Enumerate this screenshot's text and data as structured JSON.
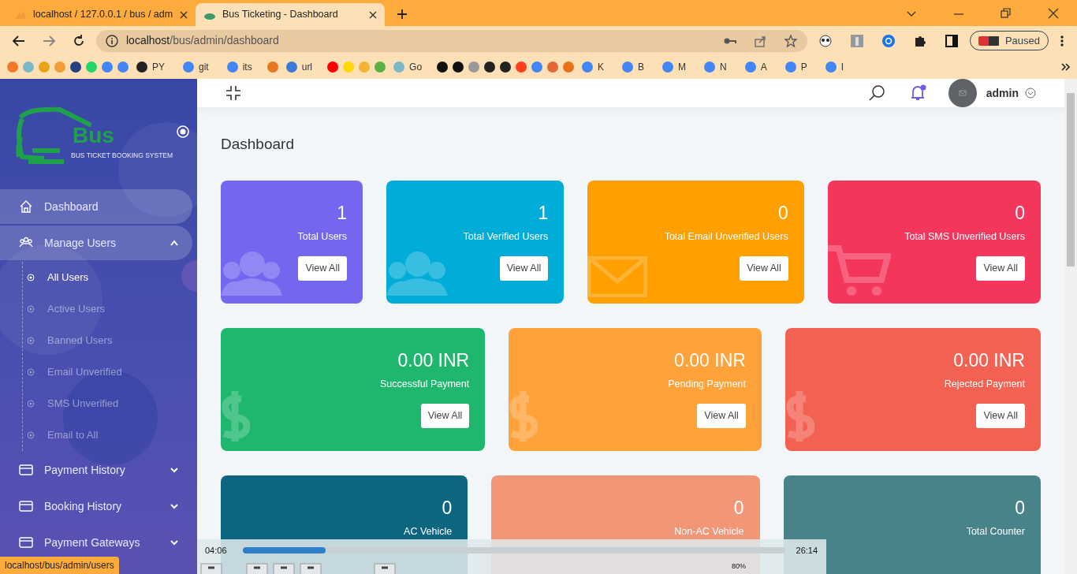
{
  "browser": {
    "tabs": [
      {
        "title": "localhost / 127.0.0.1 / bus / admi",
        "selected": false,
        "kind": "pma"
      },
      {
        "title": "Bus Ticketing - Dashboard",
        "selected": true,
        "kind": "bus"
      }
    ],
    "url_host": "localhost",
    "url_path": "/bus/admin/dashboard",
    "profile_status": "Paused",
    "bookmarks": [
      {
        "color": "#f07b2a"
      },
      {
        "color": "#7ab8c8"
      },
      {
        "color": "#e8a317"
      },
      {
        "color": "#f29d38"
      },
      {
        "color": "#23407f"
      },
      {
        "color": "#25d366"
      },
      {
        "color": "#4285f4"
      },
      {
        "color": "#4285f4"
      },
      {
        "color": "#222222",
        "label": "PY"
      },
      {
        "color": "#4285f4",
        "label": "git"
      },
      {
        "color": "#4285f4",
        "label": "its"
      },
      {
        "color": "#e87722"
      },
      {
        "color": "#3a7bd5",
        "label": "url"
      },
      {
        "color": "#ff0000"
      },
      {
        "color": "#ffd800"
      },
      {
        "color": "#f2b233"
      },
      {
        "color": "#5bb046"
      },
      {
        "color": "#7ab8c8",
        "label": "Go"
      },
      {
        "color": "#111111"
      },
      {
        "color": "#111111"
      },
      {
        "color": "#999999"
      },
      {
        "color": "#222222"
      },
      {
        "color": "#222222"
      },
      {
        "color": "#fc3f1d"
      },
      {
        "color": "#4285f4"
      },
      {
        "color": "#e16737"
      },
      {
        "color": "#e8711c"
      },
      {
        "color": "#4285f4",
        "label": "K"
      },
      {
        "color": "#4285f4",
        "label": "B"
      },
      {
        "color": "#4285f4",
        "label": "M"
      },
      {
        "color": "#4285f4",
        "label": "N"
      },
      {
        "color": "#4285f4",
        "label": "A"
      },
      {
        "color": "#4285f4",
        "label": "P"
      },
      {
        "color": "#4285f4",
        "label": "I"
      }
    ]
  },
  "sidebar": {
    "logo_word": "Bus",
    "logo_tagline": "BUS TICKET BOOKING SYSTEM",
    "items": [
      {
        "label": "Dashboard",
        "kind": "home",
        "selected": true
      },
      {
        "label": "Manage Users",
        "kind": "users",
        "selected": true,
        "expanded": true,
        "children": [
          {
            "label": "All Users",
            "selected": true
          },
          {
            "label": "Active Users",
            "selected": false
          },
          {
            "label": "Banned Users",
            "selected": false
          },
          {
            "label": "Email Unverified",
            "selected": false
          },
          {
            "label": "SMS Unverified",
            "selected": false
          },
          {
            "label": "Email to All",
            "selected": false
          }
        ]
      },
      {
        "label": "Payment History",
        "kind": "card",
        "selected": false,
        "expanded": false
      },
      {
        "label": "Booking History",
        "kind": "card",
        "selected": false,
        "expanded": false
      },
      {
        "label": "Payment Gateways",
        "kind": "card",
        "selected": false,
        "expanded": false
      }
    ]
  },
  "header": {
    "user": "admin"
  },
  "page_title": "Dashboard",
  "card_rows": [
    [
      {
        "value": "1",
        "label": "Total Users",
        "button": "View All",
        "color": "#7367f0",
        "kind": "users"
      },
      {
        "value": "1",
        "label": "Total Verified Users",
        "button": "View All",
        "color": "#00acd8",
        "kind": "users"
      },
      {
        "value": "0",
        "label": "Total Email Unverified Users",
        "button": "View All",
        "color": "#ff9f00",
        "kind": "mail"
      },
      {
        "value": "0",
        "label": "Total SMS Unverified Users",
        "button": "View All",
        "color": "#f5365c",
        "kind": "cart"
      }
    ],
    [
      {
        "value": "0.00 INR",
        "label": "Successful Payment",
        "button": "View All",
        "color": "#1fb66e",
        "kind": "dollar"
      },
      {
        "value": "0.00 INR",
        "label": "Pending Payment",
        "button": "View All",
        "color": "#ffa23a",
        "kind": "dollar"
      },
      {
        "value": "0.00 INR",
        "label": "Rejected Payment",
        "button": "View All",
        "color": "#f36152",
        "kind": "dollar"
      }
    ],
    [
      {
        "value": "0",
        "label": "AC Vehicle",
        "color": "#0d6680"
      },
      {
        "value": "0",
        "label": "Non-AC Vehicle",
        "color": "#f19778"
      },
      {
        "value": "0",
        "label": "Total Counter",
        "color": "#478389"
      }
    ]
  ],
  "player": {
    "elapsed": "04:06",
    "total": "26:14",
    "level": 0.154,
    "volume": "80%"
  },
  "status_link": "localhost/bus/admin/users"
}
